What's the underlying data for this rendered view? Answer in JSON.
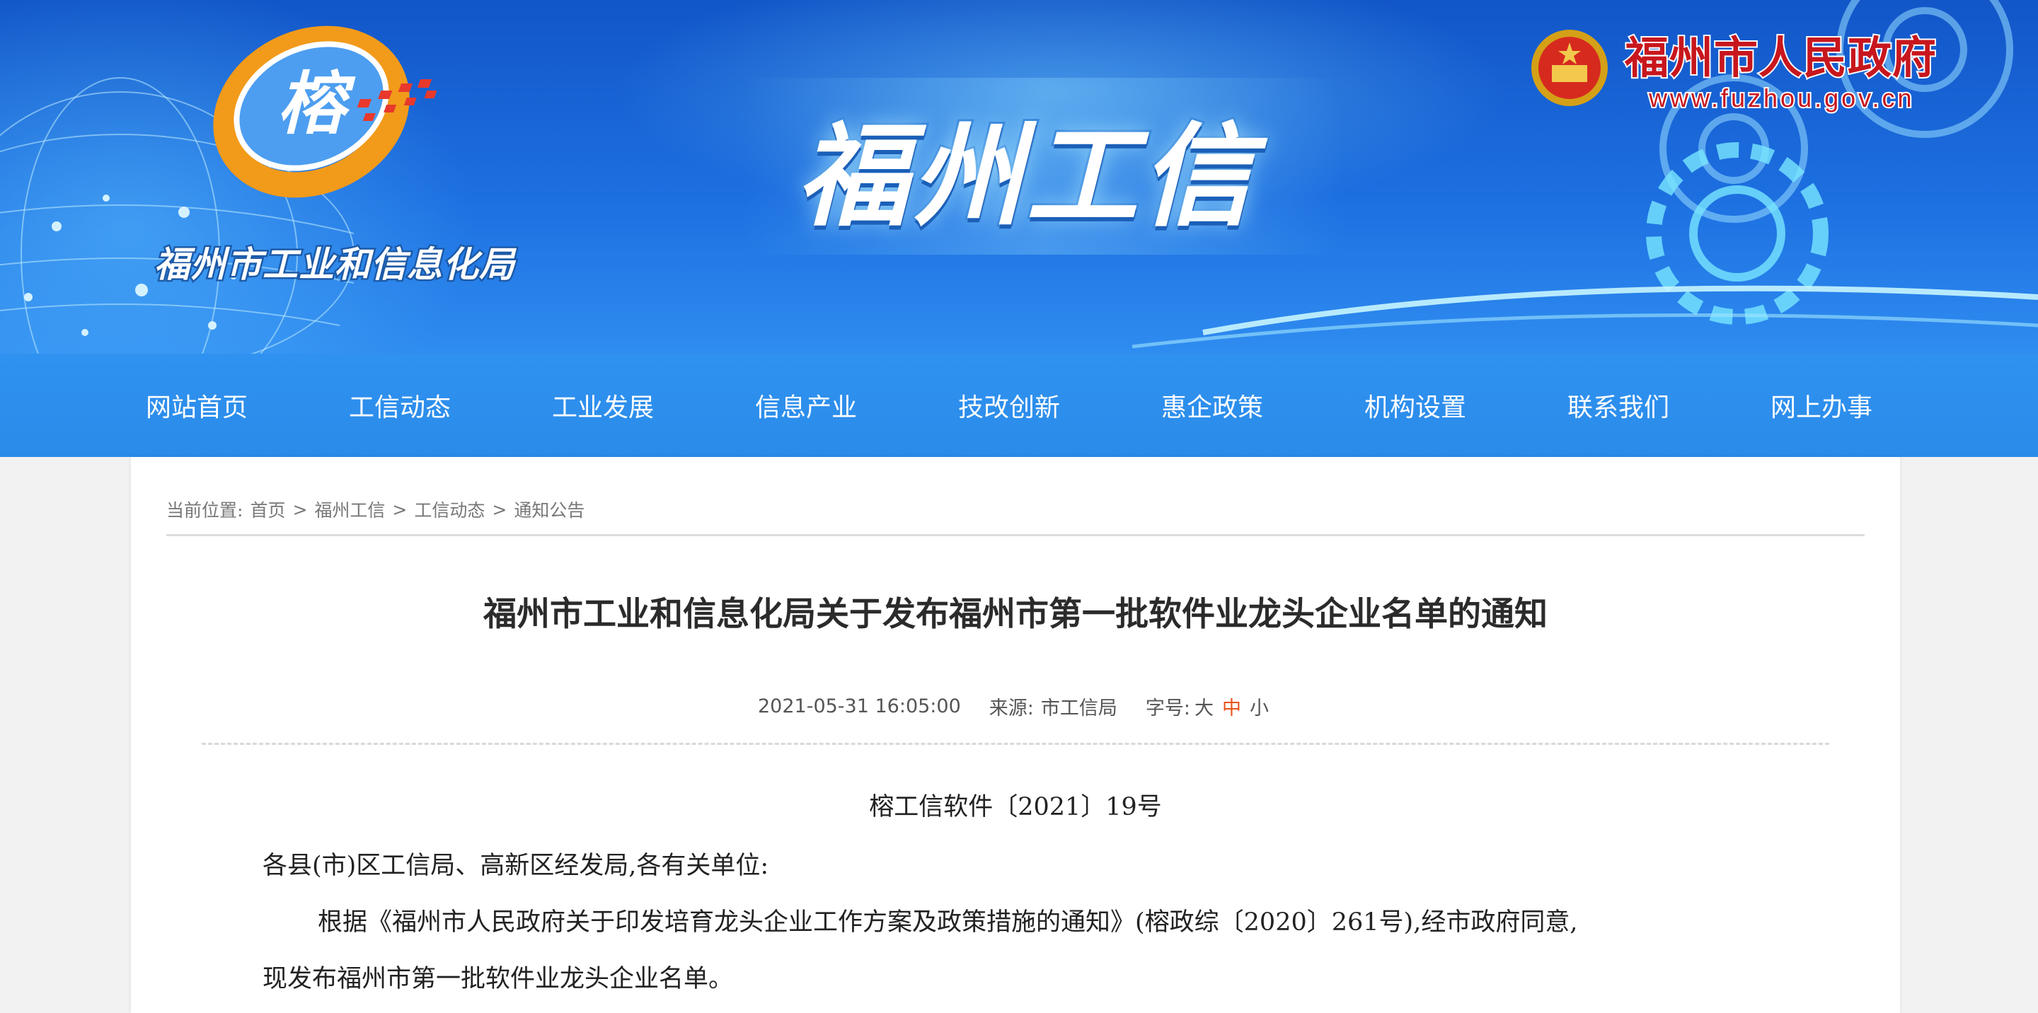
{
  "banner": {
    "site_title": "福州工信",
    "bureau_name": "福州市工业和信息化局",
    "logo_text": "榕",
    "gov_name": "福州市人民政府",
    "gov_url": "www.fuzhou.gov.cn",
    "colors": {
      "primary_blue": "#1d6fe0",
      "logo_orange": "#f29a1a",
      "gov_red": "#c8161d"
    }
  },
  "nav": {
    "items": [
      {
        "label": "网站首页"
      },
      {
        "label": "工信动态"
      },
      {
        "label": "工业发展"
      },
      {
        "label": "信息产业"
      },
      {
        "label": "技改创新"
      },
      {
        "label": "惠企政策"
      },
      {
        "label": "机构设置"
      },
      {
        "label": "联系我们"
      },
      {
        "label": "网上办事"
      }
    ]
  },
  "breadcrumb": {
    "prefix": "当前位置:",
    "items": [
      "首页",
      "福州工信",
      "工信动态",
      "通知公告"
    ],
    "separator": ">"
  },
  "article": {
    "title": "福州市工业和信息化局关于发布福州市第一批软件业龙头企业名单的通知",
    "date": "2021-05-31 16:05:00",
    "source_label": "来源:",
    "source": "市工信局",
    "font_size_label": "字号:",
    "font_sizes": [
      "大",
      "中",
      "小"
    ],
    "active_font_size": "中",
    "doc_number": "榕工信软件〔2021〕19号",
    "salutation": "各县(市)区工信局、高新区经发局,各有关单位:",
    "body_line_1": "根据《福州市人民政府关于印发培育龙头企业工作方案及政策措施的通知》(榕政综〔2020〕261号),经市政府同意,",
    "body_line_2": "现发布福州市第一批软件业龙头企业名单。"
  }
}
